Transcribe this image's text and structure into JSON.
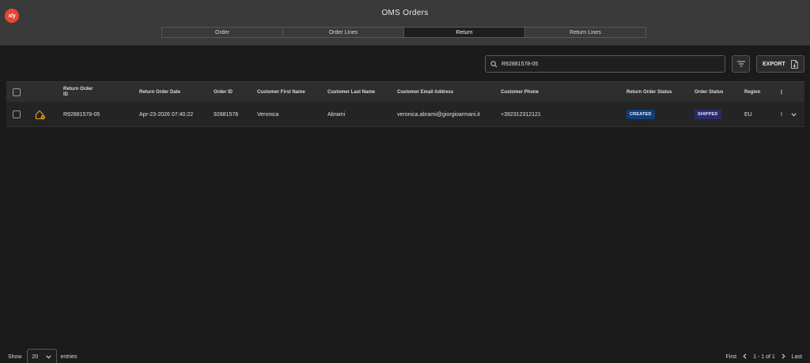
{
  "app": {
    "logo_text": "x/y",
    "title": "OMS Orders"
  },
  "tabs": [
    {
      "label": "Order",
      "active": false
    },
    {
      "label": "Order Lines",
      "active": false
    },
    {
      "label": "Return",
      "active": true
    },
    {
      "label": "Return Lines",
      "active": false
    }
  ],
  "toolbar": {
    "search_value": "R92881578-05",
    "filter_icon": "filter-icon",
    "export_label": "EXPORT",
    "export_icon": "file-export-icon"
  },
  "table": {
    "columns": [
      {
        "label": "Return Order\nID"
      },
      {
        "label": "Return Order Date"
      },
      {
        "label": "Order ID"
      },
      {
        "label": "Customer First Name"
      },
      {
        "label": "Customer Last Name"
      },
      {
        "label": "Customer Email Address"
      },
      {
        "label": "Customer Phone"
      },
      {
        "label": "Return Order Status"
      },
      {
        "label": "Order Status"
      },
      {
        "label": "Region"
      },
      {
        "label": "("
      }
    ],
    "rows": [
      {
        "row_icon": "home-return-icon",
        "return_order_id": "R92881578-05",
        "return_order_date": "Apr-23-2026 07:40:22",
        "order_id": "92881578",
        "first_name": "Veronica",
        "last_name": "Abrami",
        "email": "veronica.abrami@giorgioarmani.it",
        "phone": "+392312312121",
        "return_status": "CREATED",
        "order_status": "SHIPPED",
        "region": "EU",
        "extra": "I"
      }
    ]
  },
  "colors": {
    "header_bg": "#3a3a3a",
    "page_bg": "#1b1b1b",
    "logo": "#e64632",
    "created_badge": "#0f3f7a",
    "shipped_badge": "#2a2a6e",
    "row_icon": "#e8a21a"
  },
  "footer": {
    "show_label": "Show",
    "page_size": "20",
    "entries_label": "entries",
    "first_label": "First",
    "range_label": "1 - 1 of 1",
    "last_label": "Last"
  }
}
